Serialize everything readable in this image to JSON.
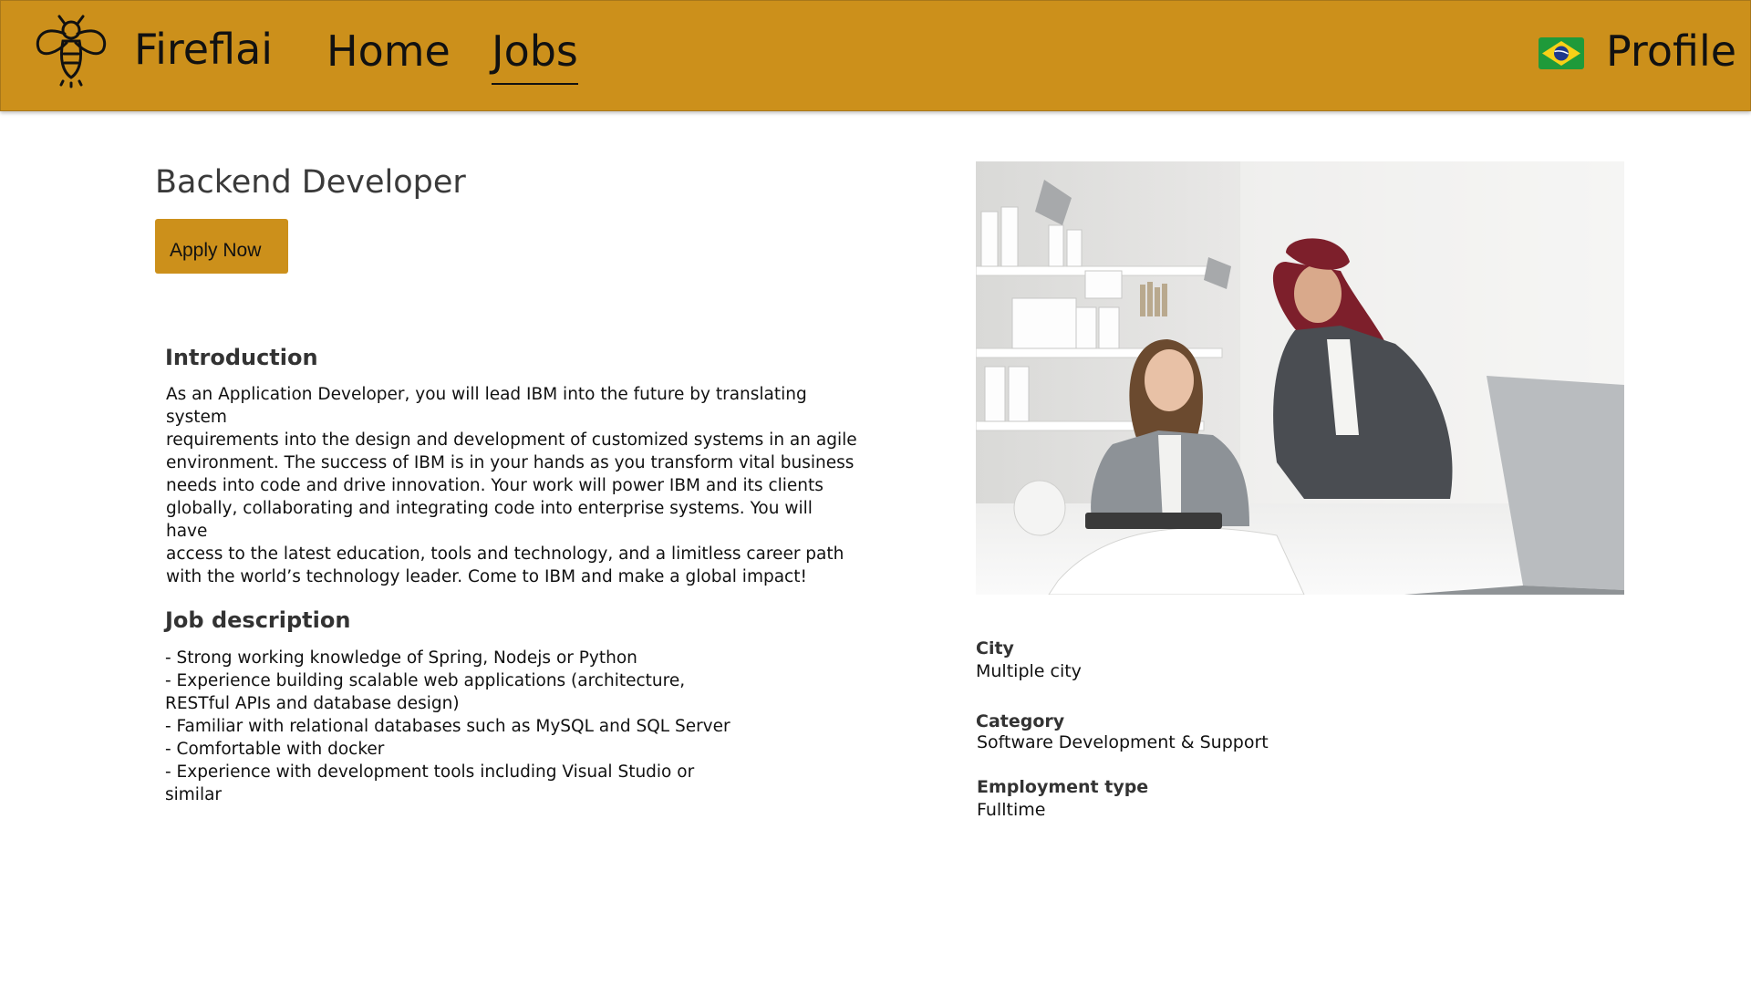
{
  "nav": {
    "brand": "Fireflai",
    "home": "Home",
    "jobs": "Jobs",
    "profile": "Profile",
    "flag_icon": "brazil-flag-icon",
    "logo_icon": "firefly-logo-icon",
    "bar_color": "#cc901b"
  },
  "job": {
    "title": "Backend Developer",
    "apply_label": "Apply Now",
    "intro_heading": "Introduction",
    "intro_lines": [
      "As an Application Developer, you will lead IBM into the future by translating system",
      "requirements into the design and development of customized systems in an agile",
      "environment.  The success of IBM is in your hands as you transform vital business",
      "needs into code and drive innovation. Your work will power IBM and its clients",
      "globally, collaborating and integrating code into enterprise systems. You will have",
      "access to the latest education, tools and technology, and a limitless career path",
      "with the world’s technology leader. Come to IBM and make a global impact!"
    ],
    "description_heading": "Job description",
    "description_lines": [
      "- Strong working knowledge of Spring, Nodejs or Python",
      "- Experience building scalable web applications (architecture,",
      "RESTful APIs and database design)",
      "- Familiar with relational databases such as MySQL and SQL Server",
      "- Comfortable with docker",
      "- Experience with development tools including Visual Studio or",
      "similar"
    ]
  },
  "details": {
    "city_label": "City",
    "city_value": "Multiple city",
    "category_label": "Category",
    "category_value": "Software Development & Support",
    "employment_label": "Employment type",
    "employment_value": "Fulltime"
  }
}
